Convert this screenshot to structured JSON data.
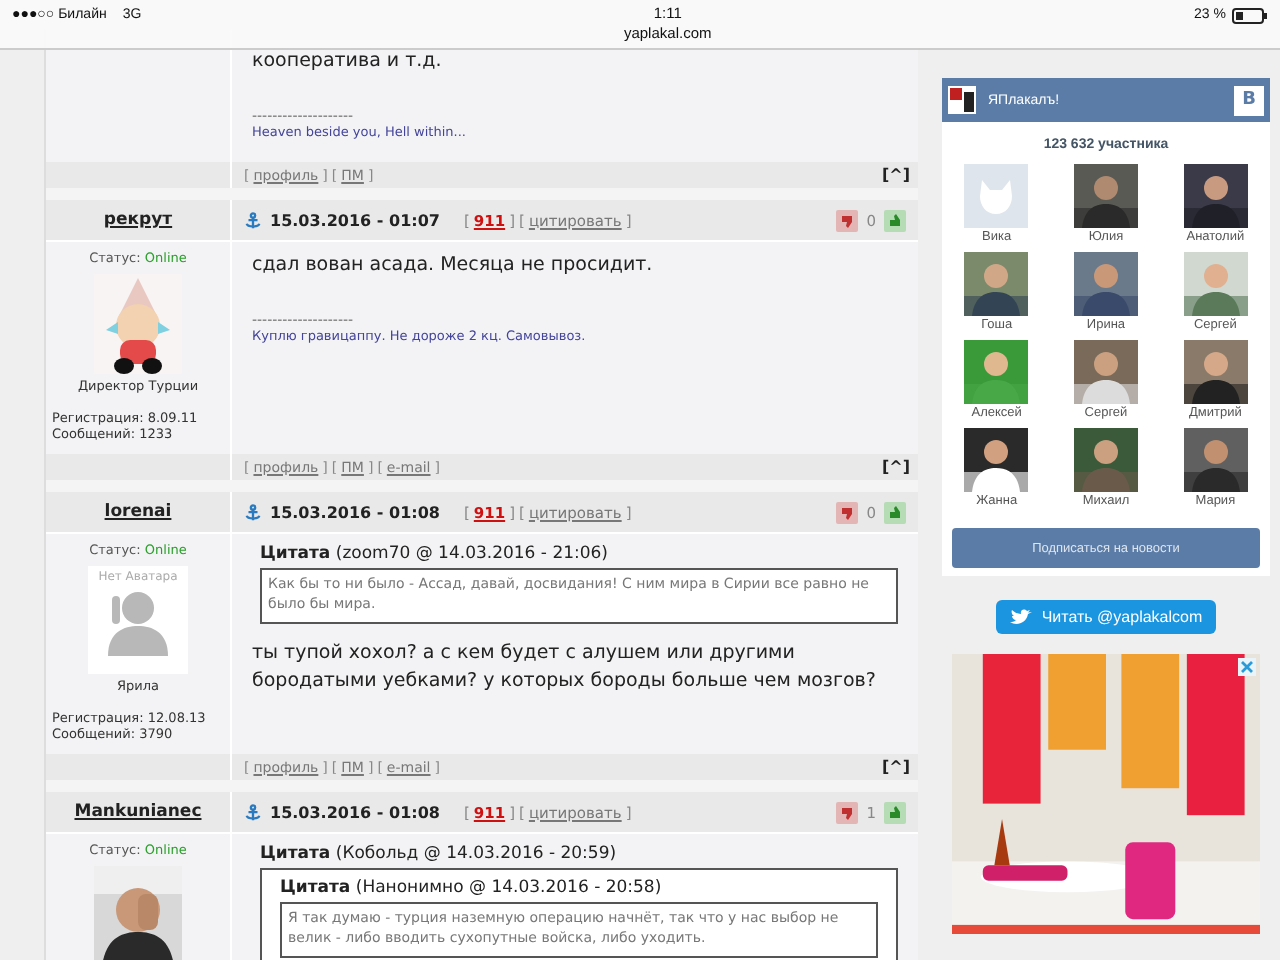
{
  "status_bar": {
    "carrier": "●●●○○ Билайн",
    "network": "3G",
    "time": "1:11",
    "url": "yaplakal.com",
    "battery": "23 %"
  },
  "posts": [
    {
      "kind": "partial",
      "body": "кооператива и т.д.",
      "signature_line": "--------------------",
      "signature": "Heaven beside you, Hell within...",
      "footer": [
        {
          "open": "[",
          "label": "профиль",
          "close": "]"
        },
        {
          "open": "[",
          "label": "ПМ",
          "close": "]"
        }
      ],
      "top_link": "[^]"
    },
    {
      "kind": "full",
      "author": "рекрут",
      "date": "15.03.2016 - 01:07",
      "header_links": [
        {
          "open": "[",
          "label": "911",
          "kind": "rating",
          "close": "]"
        },
        {
          "open": "[",
          "label": "цитировать",
          "kind": "link",
          "close": "]"
        }
      ],
      "votes": "0",
      "status_label": "Статус:",
      "status": "Online",
      "avatar": {
        "kind": "figure"
      },
      "rank": "Директор Турции",
      "registered": "Регистрация: 8.09.11",
      "messages": "Сообщений: 1233",
      "body": "сдал вован асада. Месяца не просидит.",
      "signature_line": "--------------------",
      "signature": "Куплю гравицаппу. Не дороже 2 кц. Самовывоз.",
      "footer": [
        {
          "open": "[",
          "label": "профиль",
          "close": "]"
        },
        {
          "open": "[",
          "label": "ПМ",
          "close": "]"
        },
        {
          "open": "[",
          "label": "e-mail",
          "close": "]"
        }
      ],
      "top_link": "[^]"
    },
    {
      "kind": "full",
      "author": "lorenai",
      "date": "15.03.2016 - 01:08",
      "header_links": [
        {
          "open": "[",
          "label": "911",
          "kind": "rating",
          "close": "]"
        },
        {
          "open": "[",
          "label": "цитировать",
          "kind": "link",
          "close": "]"
        }
      ],
      "votes": "0",
      "status_label": "Статус:",
      "status": "Online",
      "avatar": {
        "kind": "none",
        "placeholder": "Нет Аватара"
      },
      "rank": "Ярила",
      "registered": "Регистрация: 12.08.13",
      "messages": "Сообщений: 3790",
      "quotes": [
        {
          "title": "**Цитата** (zoom70 @ 14.03.2016 - 21:06)",
          "text": "Как бы то ни было - Ассад, давай, досвидания! С ним мира в Сирии все равно не было бы мира."
        }
      ],
      "body": "ты тупой хохол? а с кем будет с алушем или другими бородатыми уебками? у которых бороды больше чем мозгов?",
      "footer": [
        {
          "open": "[",
          "label": "профиль",
          "close": "]"
        },
        {
          "open": "[",
          "label": "ПМ",
          "close": "]"
        },
        {
          "open": "[",
          "label": "e-mail",
          "close": "]"
        }
      ],
      "top_link": "[^]"
    },
    {
      "kind": "full",
      "author": "Mankunianec",
      "date": "15.03.2016 - 01:08",
      "header_links": [
        {
          "open": "[",
          "label": "911",
          "kind": "rating",
          "close": "]"
        },
        {
          "open": "[",
          "label": "цитировать",
          "kind": "link",
          "close": "]"
        }
      ],
      "votes": "1",
      "status_label": "Статус:",
      "status": "Online",
      "avatar": {
        "kind": "picture"
      },
      "quotes": [
        {
          "title": "**Цитата** (Кобольд @ 14.03.2016 - 20:59)",
          "children": [
            {
              "title": "**Цитата** (Нанонимно @ 14.03.2016 - 20:58)",
              "text": "Я так думаю - турция наземную операцию начнёт, так что у нас выбор не велик - либо вводить сухопутные войска, либо уходить."
            }
          ]
        }
      ]
    }
  ],
  "sidebar": {
    "group": {
      "name": "ЯПлакалъ!",
      "badge": "В",
      "count": "123 632 участника",
      "members": [
        {
          "name": "Вика",
          "kind": "default"
        },
        {
          "name": "Юлия",
          "kind": "picture"
        },
        {
          "name": "Анатолий",
          "kind": "picture"
        },
        {
          "name": "Гоша",
          "kind": "picture"
        },
        {
          "name": "Ирина",
          "kind": "picture"
        },
        {
          "name": "Сергей",
          "kind": "picture"
        },
        {
          "name": "Алексей",
          "kind": "picture"
        },
        {
          "name": "Сергей",
          "kind": "picture"
        },
        {
          "name": "Дмитрий",
          "kind": "picture"
        },
        {
          "name": "Жанна",
          "kind": "picture"
        },
        {
          "name": "Михаил",
          "kind": "picture"
        },
        {
          "name": "Мария",
          "kind": "picture"
        }
      ],
      "subscribe": "Подписаться на новости"
    },
    "twitter": "Читать @yaplakalcom",
    "ad": {
      "kind": "picture"
    }
  }
}
